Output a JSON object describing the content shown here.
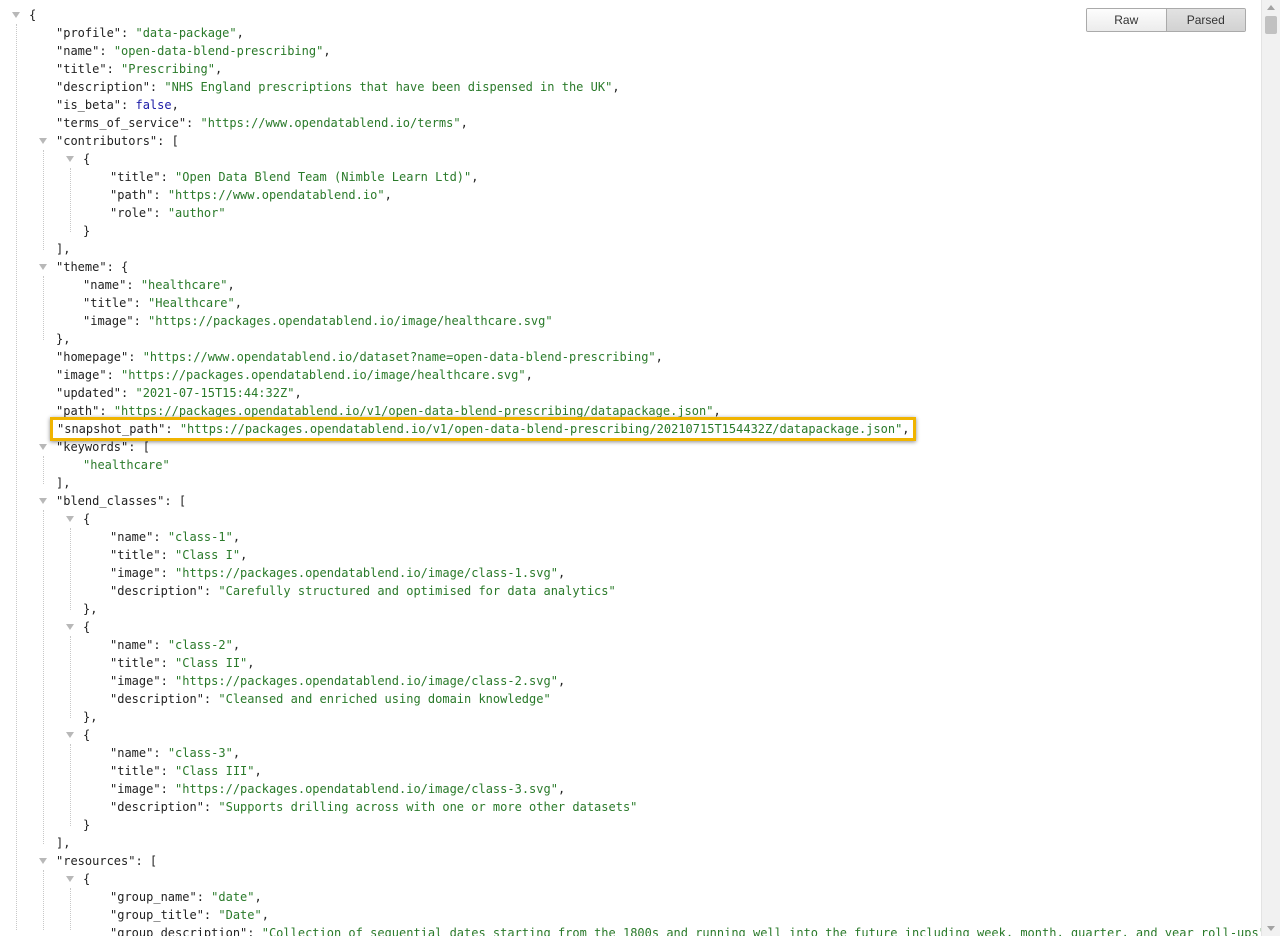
{
  "toolbar": {
    "raw_label": "Raw",
    "parsed_label": "Parsed",
    "active": "Parsed"
  },
  "colors": {
    "key": "#222222",
    "string": "#2a7a2a",
    "boolean": "#1a1aa6",
    "highlight_border": "#f0b400"
  },
  "icons": {
    "toggle": "triangle-down-icon"
  },
  "json_lines": [
    {
      "d": 0,
      "t": 1,
      "p": [
        [
          "p",
          "{"
        ]
      ]
    },
    {
      "d": 1,
      "p": [
        [
          "k",
          "\"profile\""
        ],
        [
          "p",
          ": "
        ],
        [
          "s",
          "\"data-package\""
        ],
        [
          "p",
          ","
        ]
      ]
    },
    {
      "d": 1,
      "p": [
        [
          "k",
          "\"name\""
        ],
        [
          "p",
          ": "
        ],
        [
          "s",
          "\"open-data-blend-prescribing\""
        ],
        [
          "p",
          ","
        ]
      ]
    },
    {
      "d": 1,
      "p": [
        [
          "k",
          "\"title\""
        ],
        [
          "p",
          ": "
        ],
        [
          "s",
          "\"Prescribing\""
        ],
        [
          "p",
          ","
        ]
      ]
    },
    {
      "d": 1,
      "p": [
        [
          "k",
          "\"description\""
        ],
        [
          "p",
          ": "
        ],
        [
          "s",
          "\"NHS England prescriptions that have been dispensed in the UK\""
        ],
        [
          "p",
          ","
        ]
      ]
    },
    {
      "d": 1,
      "p": [
        [
          "k",
          "\"is_beta\""
        ],
        [
          "p",
          ": "
        ],
        [
          "b",
          "false"
        ],
        [
          "p",
          ","
        ]
      ]
    },
    {
      "d": 1,
      "p": [
        [
          "k",
          "\"terms_of_service\""
        ],
        [
          "p",
          ": "
        ],
        [
          "s",
          "\"https://www.opendatablend.io/terms\""
        ],
        [
          "p",
          ","
        ]
      ]
    },
    {
      "d": 1,
      "t": 1,
      "p": [
        [
          "k",
          "\"contributors\""
        ],
        [
          "p",
          ": ["
        ]
      ]
    },
    {
      "d": 2,
      "t": 1,
      "p": [
        [
          "p",
          "{"
        ]
      ]
    },
    {
      "d": 3,
      "p": [
        [
          "k",
          "\"title\""
        ],
        [
          "p",
          ": "
        ],
        [
          "s",
          "\"Open Data Blend Team (Nimble Learn Ltd)\""
        ],
        [
          "p",
          ","
        ]
      ]
    },
    {
      "d": 3,
      "p": [
        [
          "k",
          "\"path\""
        ],
        [
          "p",
          ": "
        ],
        [
          "s",
          "\"https://www.opendatablend.io\""
        ],
        [
          "p",
          ","
        ]
      ]
    },
    {
      "d": 3,
      "p": [
        [
          "k",
          "\"role\""
        ],
        [
          "p",
          ": "
        ],
        [
          "s",
          "\"author\""
        ]
      ]
    },
    {
      "d": 2,
      "p": [
        [
          "p",
          "}"
        ]
      ]
    },
    {
      "d": 1,
      "p": [
        [
          "p",
          "],"
        ]
      ]
    },
    {
      "d": 1,
      "t": 1,
      "p": [
        [
          "k",
          "\"theme\""
        ],
        [
          "p",
          ": {"
        ]
      ]
    },
    {
      "d": 2,
      "p": [
        [
          "k",
          "\"name\""
        ],
        [
          "p",
          ": "
        ],
        [
          "s",
          "\"healthcare\""
        ],
        [
          "p",
          ","
        ]
      ]
    },
    {
      "d": 2,
      "p": [
        [
          "k",
          "\"title\""
        ],
        [
          "p",
          ": "
        ],
        [
          "s",
          "\"Healthcare\""
        ],
        [
          "p",
          ","
        ]
      ]
    },
    {
      "d": 2,
      "p": [
        [
          "k",
          "\"image\""
        ],
        [
          "p",
          ": "
        ],
        [
          "s",
          "\"https://packages.opendatablend.io/image/healthcare.svg\""
        ]
      ]
    },
    {
      "d": 1,
      "p": [
        [
          "p",
          "},"
        ]
      ]
    },
    {
      "d": 1,
      "p": [
        [
          "k",
          "\"homepage\""
        ],
        [
          "p",
          ": "
        ],
        [
          "s",
          "\"https://www.opendatablend.io/dataset?name=open-data-blend-prescribing\""
        ],
        [
          "p",
          ","
        ]
      ]
    },
    {
      "d": 1,
      "p": [
        [
          "k",
          "\"image\""
        ],
        [
          "p",
          ": "
        ],
        [
          "s",
          "\"https://packages.opendatablend.io/image/healthcare.svg\""
        ],
        [
          "p",
          ","
        ]
      ]
    },
    {
      "d": 1,
      "p": [
        [
          "k",
          "\"updated\""
        ],
        [
          "p",
          ": "
        ],
        [
          "s",
          "\"2021-07-15T15:44:32Z\""
        ],
        [
          "p",
          ","
        ]
      ]
    },
    {
      "d": 1,
      "p": [
        [
          "k",
          "\"path\""
        ],
        [
          "p",
          ": "
        ],
        [
          "s",
          "\"https://packages.opendatablend.io/v1/open-data-blend-prescribing/datapackage.json\""
        ],
        [
          "p",
          ","
        ]
      ]
    },
    {
      "d": 1,
      "p": []
    },
    {
      "d": 1,
      "t": 1,
      "p": [
        [
          "k",
          "\"keywords\""
        ],
        [
          "p",
          ": ["
        ]
      ]
    },
    {
      "d": 2,
      "p": [
        [
          "s",
          "\"healthcare\""
        ]
      ]
    },
    {
      "d": 1,
      "p": [
        [
          "p",
          "],"
        ]
      ]
    },
    {
      "d": 1,
      "t": 1,
      "p": [
        [
          "k",
          "\"blend_classes\""
        ],
        [
          "p",
          ": ["
        ]
      ]
    },
    {
      "d": 2,
      "t": 1,
      "p": [
        [
          "p",
          "{"
        ]
      ]
    },
    {
      "d": 3,
      "p": [
        [
          "k",
          "\"name\""
        ],
        [
          "p",
          ": "
        ],
        [
          "s",
          "\"class-1\""
        ],
        [
          "p",
          ","
        ]
      ]
    },
    {
      "d": 3,
      "p": [
        [
          "k",
          "\"title\""
        ],
        [
          "p",
          ": "
        ],
        [
          "s",
          "\"Class I\""
        ],
        [
          "p",
          ","
        ]
      ]
    },
    {
      "d": 3,
      "p": [
        [
          "k",
          "\"image\""
        ],
        [
          "p",
          ": "
        ],
        [
          "s",
          "\"https://packages.opendatablend.io/image/class-1.svg\""
        ],
        [
          "p",
          ","
        ]
      ]
    },
    {
      "d": 3,
      "p": [
        [
          "k",
          "\"description\""
        ],
        [
          "p",
          ": "
        ],
        [
          "s",
          "\"Carefully structured and optimised for data analytics\""
        ]
      ]
    },
    {
      "d": 2,
      "p": [
        [
          "p",
          "},"
        ]
      ]
    },
    {
      "d": 2,
      "t": 1,
      "p": [
        [
          "p",
          "{"
        ]
      ]
    },
    {
      "d": 3,
      "p": [
        [
          "k",
          "\"name\""
        ],
        [
          "p",
          ": "
        ],
        [
          "s",
          "\"class-2\""
        ],
        [
          "p",
          ","
        ]
      ]
    },
    {
      "d": 3,
      "p": [
        [
          "k",
          "\"title\""
        ],
        [
          "p",
          ": "
        ],
        [
          "s",
          "\"Class II\""
        ],
        [
          "p",
          ","
        ]
      ]
    },
    {
      "d": 3,
      "p": [
        [
          "k",
          "\"image\""
        ],
        [
          "p",
          ": "
        ],
        [
          "s",
          "\"https://packages.opendatablend.io/image/class-2.svg\""
        ],
        [
          "p",
          ","
        ]
      ]
    },
    {
      "d": 3,
      "p": [
        [
          "k",
          "\"description\""
        ],
        [
          "p",
          ": "
        ],
        [
          "s",
          "\"Cleansed and enriched using domain knowledge\""
        ]
      ]
    },
    {
      "d": 2,
      "p": [
        [
          "p",
          "},"
        ]
      ]
    },
    {
      "d": 2,
      "t": 1,
      "p": [
        [
          "p",
          "{"
        ]
      ]
    },
    {
      "d": 3,
      "p": [
        [
          "k",
          "\"name\""
        ],
        [
          "p",
          ": "
        ],
        [
          "s",
          "\"class-3\""
        ],
        [
          "p",
          ","
        ]
      ]
    },
    {
      "d": 3,
      "p": [
        [
          "k",
          "\"title\""
        ],
        [
          "p",
          ": "
        ],
        [
          "s",
          "\"Class III\""
        ],
        [
          "p",
          ","
        ]
      ]
    },
    {
      "d": 3,
      "p": [
        [
          "k",
          "\"image\""
        ],
        [
          "p",
          ": "
        ],
        [
          "s",
          "\"https://packages.opendatablend.io/image/class-3.svg\""
        ],
        [
          "p",
          ","
        ]
      ]
    },
    {
      "d": 3,
      "p": [
        [
          "k",
          "\"description\""
        ],
        [
          "p",
          ": "
        ],
        [
          "s",
          "\"Supports drilling across with one or more other datasets\""
        ]
      ]
    },
    {
      "d": 2,
      "p": [
        [
          "p",
          "}"
        ]
      ]
    },
    {
      "d": 1,
      "p": [
        [
          "p",
          "],"
        ]
      ]
    },
    {
      "d": 1,
      "t": 1,
      "p": [
        [
          "k",
          "\"resources\""
        ],
        [
          "p",
          ": ["
        ]
      ]
    },
    {
      "d": 2,
      "t": 1,
      "p": [
        [
          "p",
          "{"
        ]
      ]
    },
    {
      "d": 3,
      "p": [
        [
          "k",
          "\"group_name\""
        ],
        [
          "p",
          ": "
        ],
        [
          "s",
          "\"date\""
        ],
        [
          "p",
          ","
        ]
      ]
    },
    {
      "d": 3,
      "p": [
        [
          "k",
          "\"group_title\""
        ],
        [
          "p",
          ": "
        ],
        [
          "s",
          "\"Date\""
        ],
        [
          "p",
          ","
        ]
      ]
    },
    {
      "d": 3,
      "p": [
        [
          "k",
          "\"group_description\""
        ],
        [
          "p",
          ": "
        ],
        [
          "s",
          "\"Collection of sequential dates starting from the 1800s and running well into the future including week, month, quarter, and year roll-ups\""
        ],
        [
          "p",
          ","
        ]
      ]
    }
  ],
  "highlighted_line": {
    "p": [
      [
        "k",
        "\"snapshot_path\""
      ],
      [
        "p",
        ": "
      ],
      [
        "s",
        "\"https://packages.opendatablend.io/v1/open-data-blend-prescribing/20210715T154432Z/datapackage.json\""
      ],
      [
        "p",
        ","
      ]
    ]
  }
}
